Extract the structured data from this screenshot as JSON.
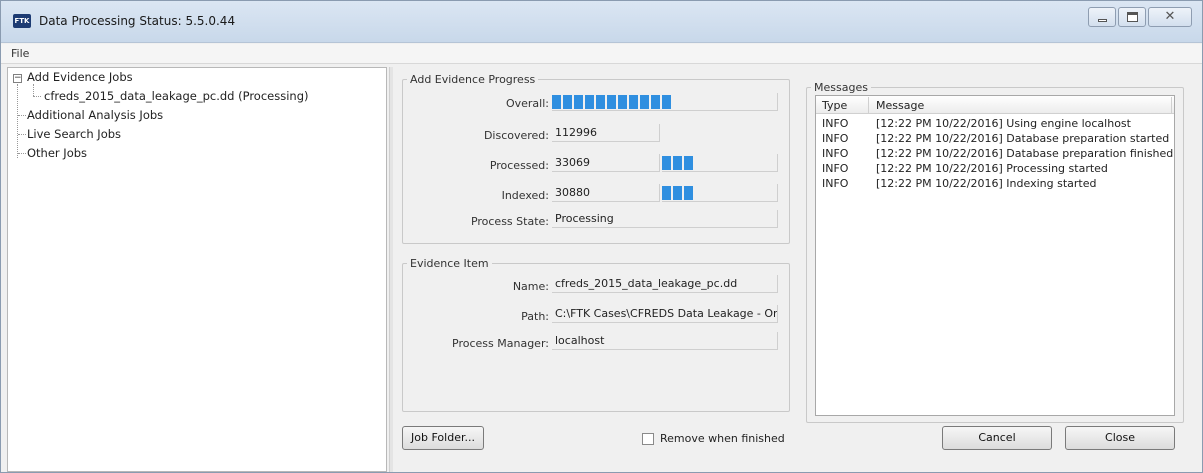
{
  "window": {
    "title": "Data Processing Status: 5.5.0.44",
    "icon_text": "FTK"
  },
  "menu": {
    "file": "File"
  },
  "tree": {
    "root": "Add Evidence Jobs",
    "child": "cfreds_2015_data_leakage_pc.dd (Processing)",
    "items": [
      "Additional Analysis Jobs",
      "Live Search Jobs",
      "Other Jobs"
    ]
  },
  "progress": {
    "legend": "Add Evidence Progress",
    "overall_label": "Overall:",
    "overall_fraction": 0.53,
    "discovered_label": "Discovered:",
    "discovered_value": "112996",
    "processed_label": "Processed:",
    "processed_value": "33069",
    "processed_fraction": 0.29,
    "indexed_label": "Indexed:",
    "indexed_value": "30880",
    "indexed_fraction": 0.27,
    "state_label": "Process State:",
    "state_value": "Processing"
  },
  "evidence": {
    "legend": "Evidence Item",
    "name_label": "Name:",
    "name_value": "cfreds_2015_data_leakage_pc.dd",
    "path_label": "Path:",
    "path_value": "C:\\FTK Cases\\CFREDS Data Leakage - Origin",
    "manager_label": "Process Manager:",
    "manager_value": "localhost"
  },
  "messages": {
    "legend": "Messages",
    "col_type": "Type",
    "col_message": "Message",
    "rows": [
      {
        "type": "INFO",
        "message": "[12:22 PM 10/22/2016] Using engine localhost"
      },
      {
        "type": "INFO",
        "message": "[12:22 PM 10/22/2016] Database preparation started"
      },
      {
        "type": "INFO",
        "message": "[12:22 PM 10/22/2016] Database preparation finished"
      },
      {
        "type": "INFO",
        "message": "[12:22 PM 10/22/2016] Processing started"
      },
      {
        "type": "INFO",
        "message": "[12:22 PM 10/22/2016] Indexing started"
      }
    ]
  },
  "footer": {
    "job_folder": "Job Folder...",
    "remove_when_finished": "Remove when finished",
    "remove_checked": false,
    "cancel": "Cancel",
    "close": "Close"
  }
}
